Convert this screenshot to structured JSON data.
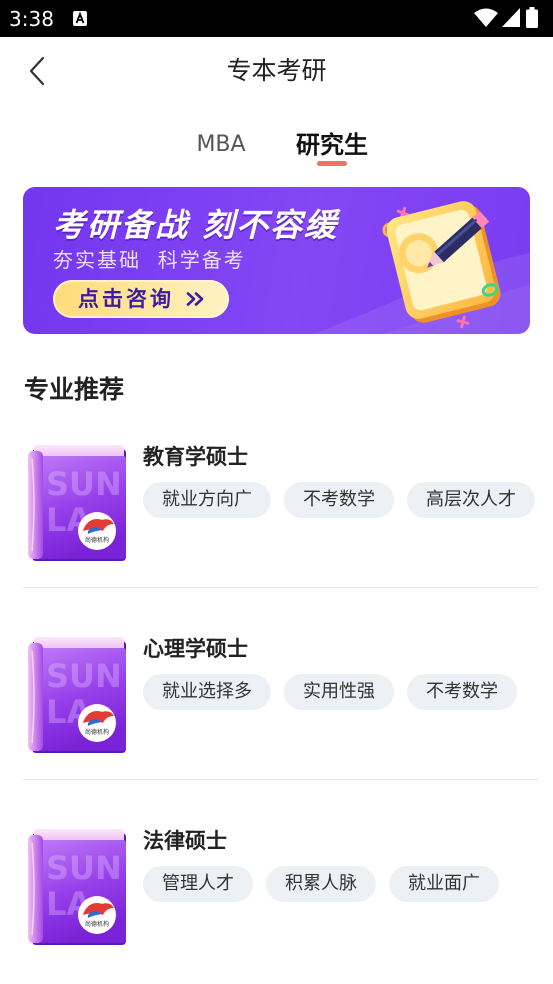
{
  "status_bar": {
    "time": "3:38"
  },
  "header": {
    "title": "专本考研"
  },
  "tabs": [
    {
      "label": "MBA",
      "active": false
    },
    {
      "label": "研究生",
      "active": true
    }
  ],
  "banner": {
    "title": "考研备战 刻不容缓",
    "subtitle": "夯实基础  科学备考",
    "button_label": "点击咨询"
  },
  "section": {
    "title": "专业推荐"
  },
  "book_cover": {
    "watermark_line1": "SUN",
    "watermark_line2": "LA",
    "logo_text": "尚德机构"
  },
  "majors": [
    {
      "title": "教育学硕士",
      "tags": [
        "就业方向广",
        "不考数学",
        "高层次人才"
      ]
    },
    {
      "title": "心理学硕士",
      "tags": [
        "就业选择多",
        "实用性强",
        "不考数学"
      ]
    },
    {
      "title": "法律硕士",
      "tags": [
        "管理人才",
        "积累人脉",
        "就业面广"
      ]
    }
  ],
  "colors": {
    "accent": "#f0706a",
    "banner_purple": "#7b3ff2",
    "tag_background": "#edf1f6",
    "button_yellow": "#ffe08a",
    "text_primary": "#222222"
  },
  "icons": {
    "back": "chevron-left-icon",
    "status": [
      "notification-a-icon",
      "wifi-icon",
      "signal-icon",
      "battery-icon"
    ],
    "banner_button": "double-chevron-right-icon",
    "banner_art": "notepad-pencil-illustration",
    "major_cover": "book-icon"
  }
}
